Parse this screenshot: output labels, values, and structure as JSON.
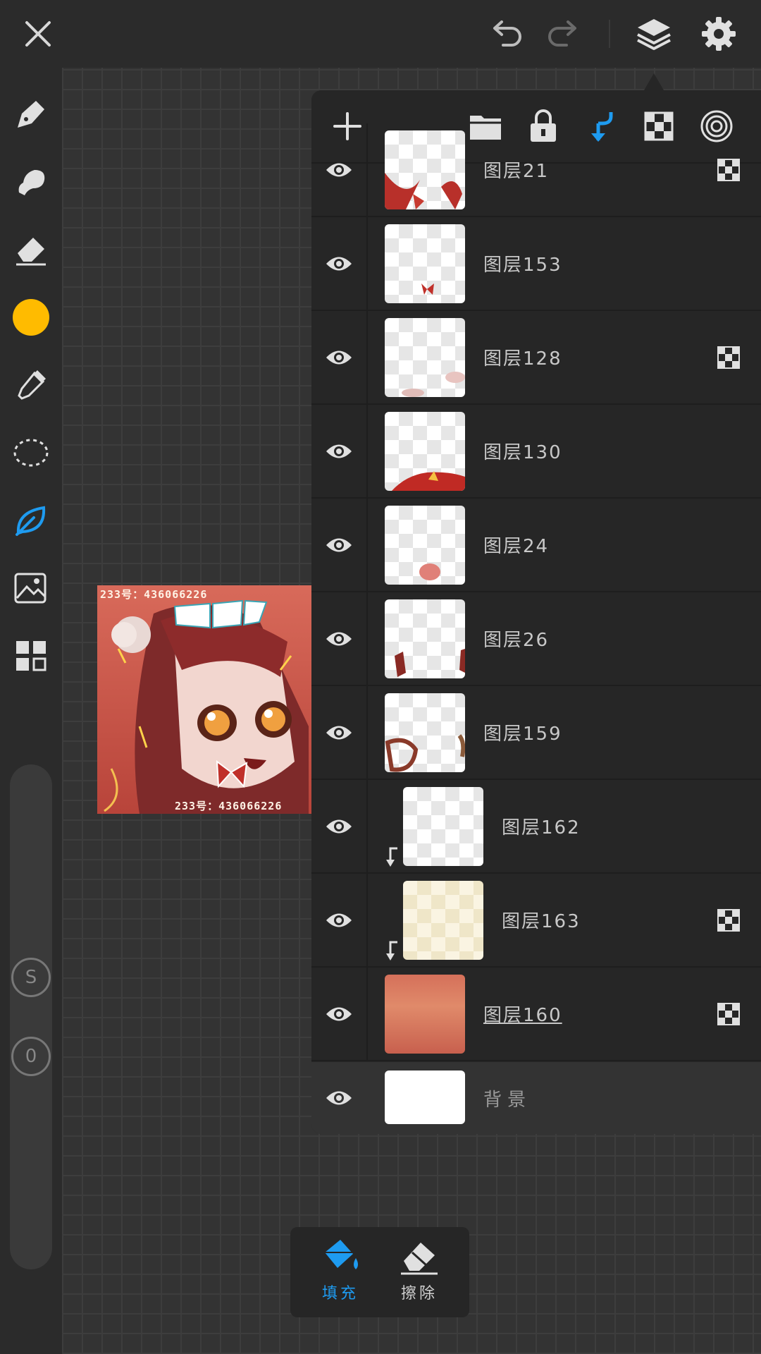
{
  "topbar": {
    "close_icon": "close-icon",
    "undo_icon": "undo-icon",
    "redo_icon": "redo-icon",
    "layers_icon": "layers-icon",
    "settings_icon": "gear-icon"
  },
  "colors": {
    "accent": "#1e9bf0",
    "current_color": "#ffbb00",
    "panel_bg": "#262626",
    "canvas_bg": "#333333"
  },
  "toolbar": {
    "tools": [
      "pen-icon",
      "smudge-icon",
      "eraser-icon",
      "color-swatch",
      "eyedropper-icon",
      "lasso-icon",
      "leaf-icon",
      "image-import-icon",
      "gallery-icon"
    ],
    "active_tool": "leaf-icon",
    "size_label": "S",
    "opacity_label": "0"
  },
  "artwork": {
    "top_text": "233号：436066226",
    "bottom_text": "233号：436066226"
  },
  "layers": [
    {
      "name": "图层21",
      "alpha_locked": true,
      "clipped": false
    },
    {
      "name": "图层153",
      "alpha_locked": false,
      "clipped": false
    },
    {
      "name": "图层128",
      "alpha_locked": true,
      "clipped": false
    },
    {
      "name": "图层130",
      "alpha_locked": false,
      "clipped": false
    },
    {
      "name": "图层24",
      "alpha_locked": false,
      "clipped": false
    },
    {
      "name": "图层26",
      "alpha_locked": false,
      "clipped": false
    },
    {
      "name": "图层159",
      "alpha_locked": false,
      "clipped": false
    },
    {
      "name": "图层162",
      "alpha_locked": false,
      "clipped": true
    },
    {
      "name": "图层163",
      "alpha_locked": true,
      "clipped": true
    },
    {
      "name": "图层160",
      "alpha_locked": true,
      "clipped": false
    }
  ],
  "background_layer": {
    "name": "背景"
  },
  "bottom_tools": {
    "fill_label": "填充",
    "erase_label": "擦除"
  }
}
